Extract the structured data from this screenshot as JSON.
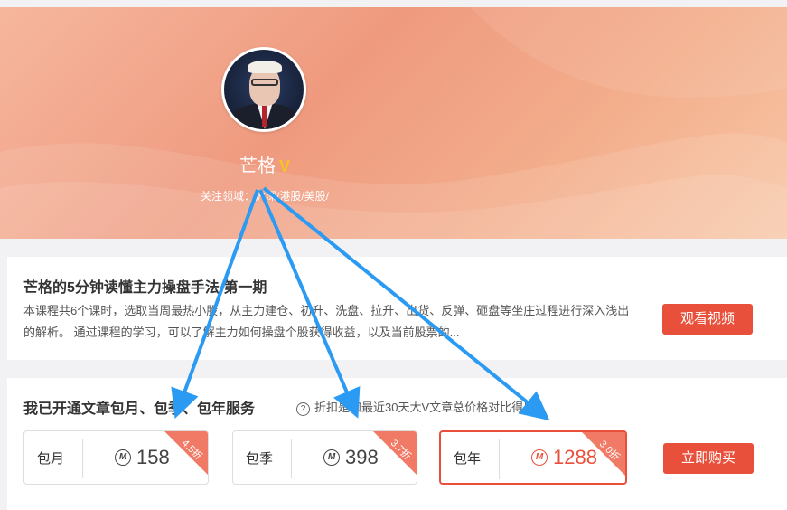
{
  "profile": {
    "name": "芒格",
    "verified_icon": "V",
    "focus_label": "关注领域：",
    "focus_value": "沪深/港股/美股/"
  },
  "course": {
    "title": "芒格的5分钟读懂主力操盘手法 第一期",
    "description": "本课程共6个课时，选取当周最热小股，从主力建仓、初升、洗盘、拉升、出货、反弹、砸盘等坐庄过程进行深入浅出的解析。 通过课程的学习，可以了解主力如何操盘个股获得收益，以及当前股票的...",
    "watch_button": "观看视频"
  },
  "subscription": {
    "title": "我已开通文章包月、包季、包年服务",
    "help_icon": "?",
    "note": "折扣是和最近30天大V文章总价格对比得出",
    "coin_icon": "M",
    "plans": [
      {
        "name": "包月",
        "price": "158",
        "discount": "4.5折",
        "selected": false
      },
      {
        "name": "包季",
        "price": "398",
        "discount": "3.7折",
        "selected": false
      },
      {
        "name": "包年",
        "price": "1288",
        "discount": "3.0折",
        "selected": true
      }
    ],
    "buy_button": "立即购买"
  },
  "colors": {
    "accent": "#e9503b",
    "ribbon": "#f07a65",
    "verified": "#f7c31f",
    "annotation_arrow": "#2b9af3"
  }
}
